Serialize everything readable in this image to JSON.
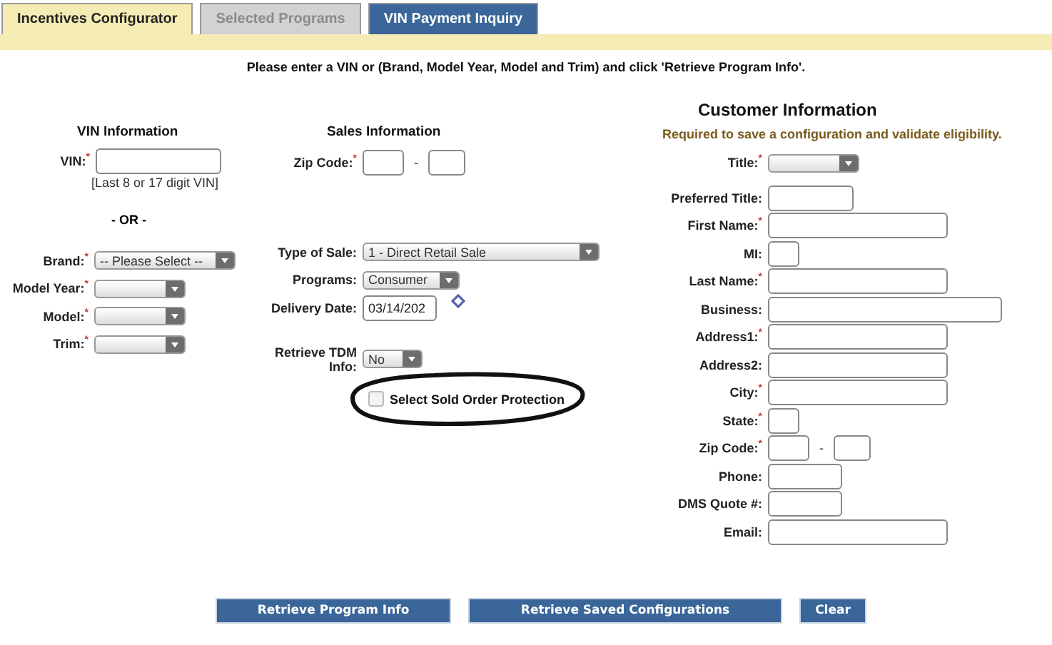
{
  "tabs": [
    {
      "label": "Incentives Configurator",
      "selected": true,
      "disabled": false
    },
    {
      "label": "Selected Programs",
      "selected": false,
      "disabled": true
    },
    {
      "label": "VIN Payment Inquiry",
      "selected": false,
      "disabled": false
    }
  ],
  "instruction": "Please enter a VIN or (Brand, Model Year, Model and Trim) and click 'Retrieve Program Info'.",
  "vin_info": {
    "heading": "VIN Information",
    "vin_label": "VIN:$^{*}$",
    "vin_hint": "[Last 8 or 17 digit VIN]",
    "separator": "- OR -",
    "fields": [
      {
        "label": "Brand:$^{*}$",
        "kind": "longselect",
        "value": "-- Please Select --"
      },
      {
        "label": "Model Year:$^{*}$",
        "kind": "select"
      },
      {
        "label": "Model:$^{*}$",
        "kind": "select"
      },
      {
        "label": "Trim:$^{*}$",
        "kind": "select"
      }
    ]
  },
  "sales_info": {
    "heading": "Sales Information",
    "fields": [
      {
        "label": "Zip Code:$^{*}$",
        "kind": "zip",
        "separator": "-"
      },
      {
        "label": "Type of Sale:",
        "kind": "longselect",
        "value": "1 - Direct Retail Sale"
      },
      {
        "label": "Programs:",
        "kind": "select",
        "value": "Consumer"
      },
      {
        "label": "Delivery Date:",
        "kind": "date",
        "value": "03/14/202"
      },
      {
        "label": "Retrieve TDM Info:",
        "kind": "tinyselect",
        "value": "No"
      }
    ],
    "checkbox": {
      "label": "Select Sold Order Protection",
      "checked": false
    }
  },
  "customer_info": {
    "heading": "Customer Information",
    "note": "Required to save a configuration and validate eligibility.",
    "fields": [
      {
        "label": "Title:$^{*}$",
        "kind": "select"
      },
      {
        "label": "Preferred Title:",
        "kind": "medium"
      },
      {
        "label": "First Name:$^{*}$",
        "kind": "long"
      },
      {
        "label": "MI:",
        "kind": "tiny"
      },
      {
        "label": "Last Name:$^{*}$",
        "kind": "long"
      },
      {
        "label": "Business:",
        "kind": "wide"
      },
      {
        "label": "Address1:$^{*}$",
        "kind": "long"
      },
      {
        "label": "Address2:",
        "kind": "long"
      },
      {
        "label": "City:$^{*}$",
        "kind": "long"
      },
      {
        "label": "State:$^{*}$",
        "kind": "tiny"
      },
      {
        "label": "Zip Code:$^{*}$",
        "kind": "zip",
        "separator": "-"
      },
      {
        "label": "Phone:",
        "kind": "short"
      },
      {
        "label": "DMS Quote #:",
        "kind": "short"
      },
      {
        "label": "Email:",
        "kind": "long"
      }
    ]
  },
  "buttons": [
    "Retrieve Program Info",
    "Retrieve Saved Configurations",
    "Clear"
  ]
}
